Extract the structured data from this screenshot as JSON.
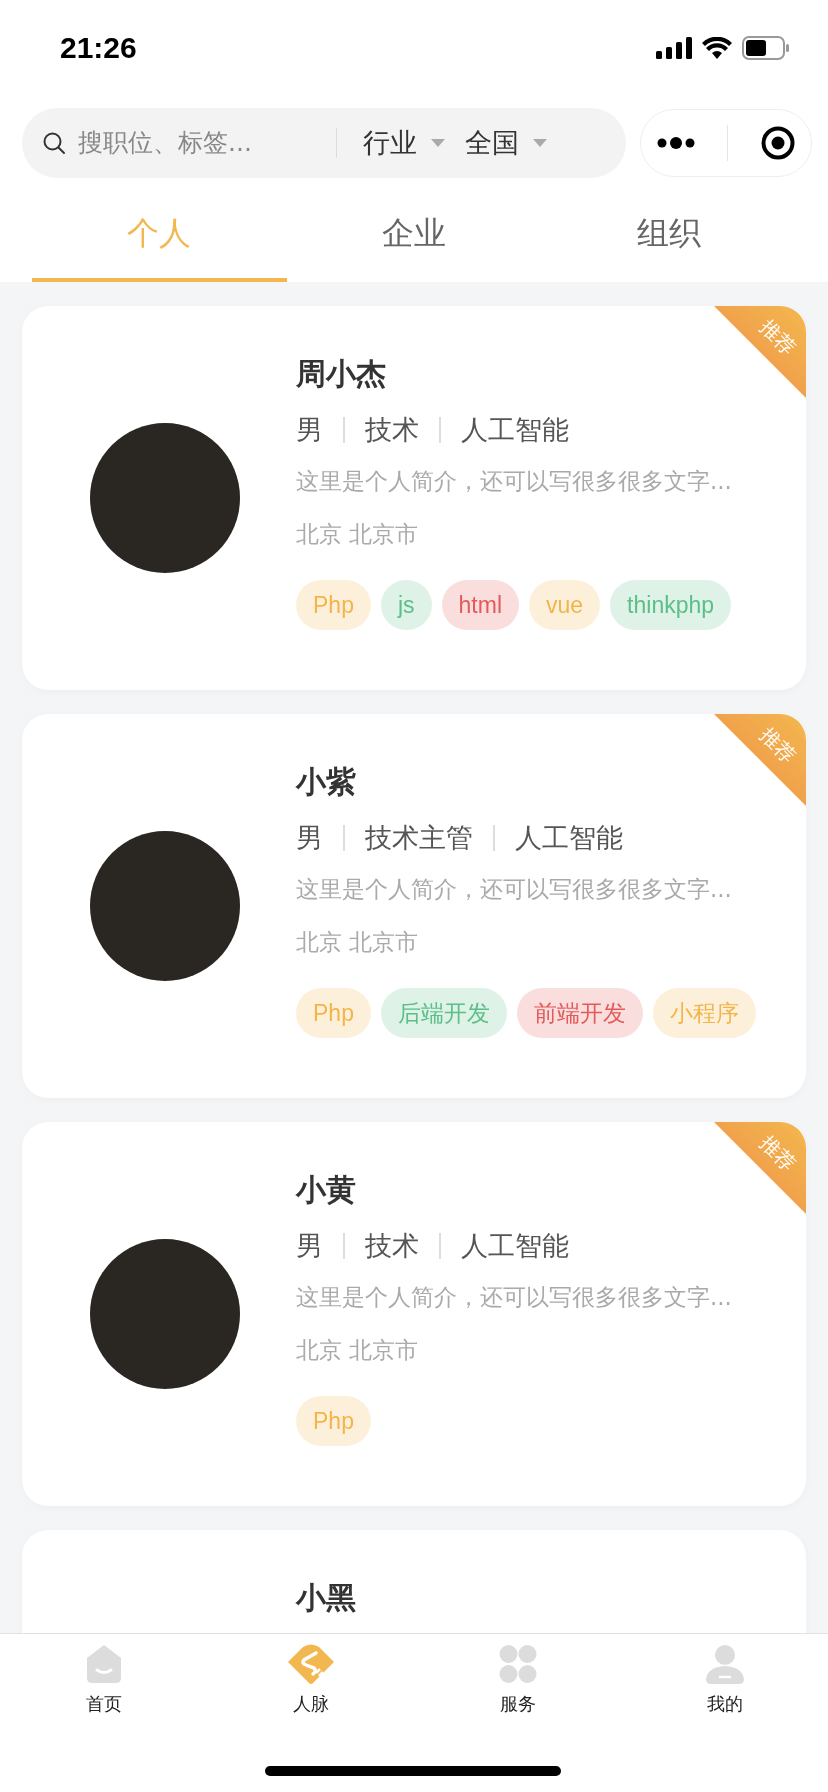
{
  "status_bar": {
    "time": "21:26"
  },
  "search": {
    "placeholder": "搜职位、标签..."
  },
  "filters": [
    {
      "label": "行业"
    },
    {
      "label": "全国"
    }
  ],
  "tabs": [
    {
      "label": "个人",
      "selected": true
    },
    {
      "label": "企业",
      "selected": false
    },
    {
      "label": "组织",
      "selected": false
    }
  ],
  "cards": [
    {
      "name": "周小杰",
      "badge": "推荐",
      "meta": [
        "男",
        "技术",
        "人工智能"
      ],
      "intro": "这里是个人简介，还可以写很多很多文字...",
      "location": "北京 北京市",
      "tags": [
        {
          "label": "Php",
          "color": "#f3b54a"
        },
        {
          "label": "js",
          "color": "#5bbf87"
        },
        {
          "label": "html",
          "color": "#e45a5a"
        },
        {
          "label": "vue",
          "color": "#f3b54a"
        },
        {
          "label": "thinkphp",
          "color": "#5bbf87"
        }
      ]
    },
    {
      "name": "小紫",
      "badge": "推荐",
      "meta": [
        "男",
        "技术主管",
        "人工智能"
      ],
      "intro": "这里是个人简介，还可以写很多很多文字...",
      "location": "北京 北京市",
      "tags": [
        {
          "label": "Php",
          "color": "#f3b54a"
        },
        {
          "label": "后端开发",
          "color": "#5bbf87"
        },
        {
          "label": "前端开发",
          "color": "#e45a5a"
        },
        {
          "label": "小程序",
          "color": "#f3b54a"
        }
      ]
    },
    {
      "name": "小黄",
      "badge": "推荐",
      "meta": [
        "男",
        "技术",
        "人工智能"
      ],
      "intro": "这里是个人简介，还可以写很多很多文字...",
      "location": "北京 北京市",
      "tags": [
        {
          "label": "Php",
          "color": "#f3b54a"
        }
      ]
    },
    {
      "name": "小黑"
    }
  ],
  "tab_bar": [
    {
      "label": "首页",
      "kind": "home",
      "selected": false
    },
    {
      "label": "人脉",
      "kind": "contacts",
      "selected": true
    },
    {
      "label": "服务",
      "kind": "services",
      "selected": false
    },
    {
      "label": "我的",
      "kind": "profile",
      "selected": false
    }
  ]
}
